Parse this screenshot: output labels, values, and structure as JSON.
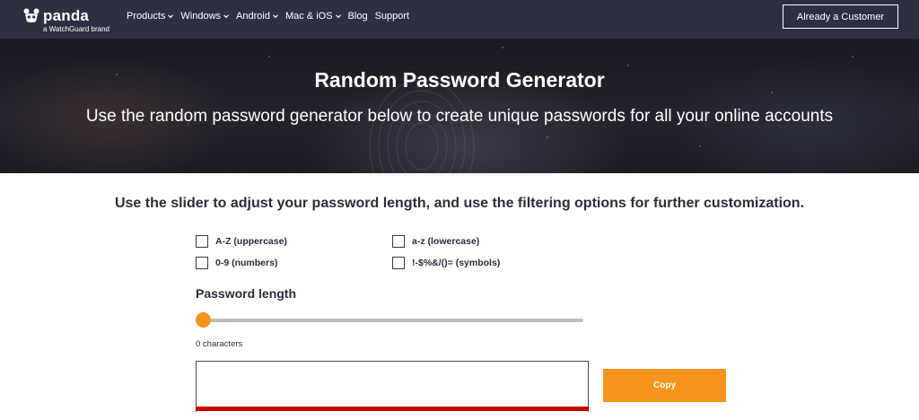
{
  "nav": {
    "logo_word": "panda",
    "logo_sub": "a WatchGuard brand",
    "items": [
      {
        "label": "Products",
        "dropdown": true
      },
      {
        "label": "Windows",
        "dropdown": true
      },
      {
        "label": "Android",
        "dropdown": true
      },
      {
        "label": "Mac & iOS",
        "dropdown": true
      },
      {
        "label": "Blog",
        "dropdown": false
      },
      {
        "label": "Support",
        "dropdown": false
      }
    ],
    "customer_button": "Already a Customer"
  },
  "hero": {
    "title": "Random Password Generator",
    "subtitle": "Use the random password generator below to create unique passwords for all your online accounts"
  },
  "generator": {
    "instructions": "Use the slider to adjust your password length, and use the filtering options for further customization.",
    "options": {
      "uppercase": {
        "label": "A-Z (uppercase)",
        "checked": false
      },
      "lowercase": {
        "label": "a-z (lowercase)",
        "checked": false
      },
      "numbers": {
        "label": "0-9 (numbers)",
        "checked": false
      },
      "symbols": {
        "label": "!-$%&/()= (symbols)",
        "checked": false
      }
    },
    "length_label": "Password length",
    "length_value": 0,
    "characters_text": "0 characters",
    "password_value": "",
    "copy_button": "Copy"
  },
  "colors": {
    "nav_bg": "#2d3042",
    "accent_orange": "#f7941d",
    "strength_bar_red": "#cc0000",
    "text_dark": "#2b2d3b"
  },
  "icons": {
    "logo": "panda-logo-icon",
    "dropdown": "chevron-down-icon"
  }
}
